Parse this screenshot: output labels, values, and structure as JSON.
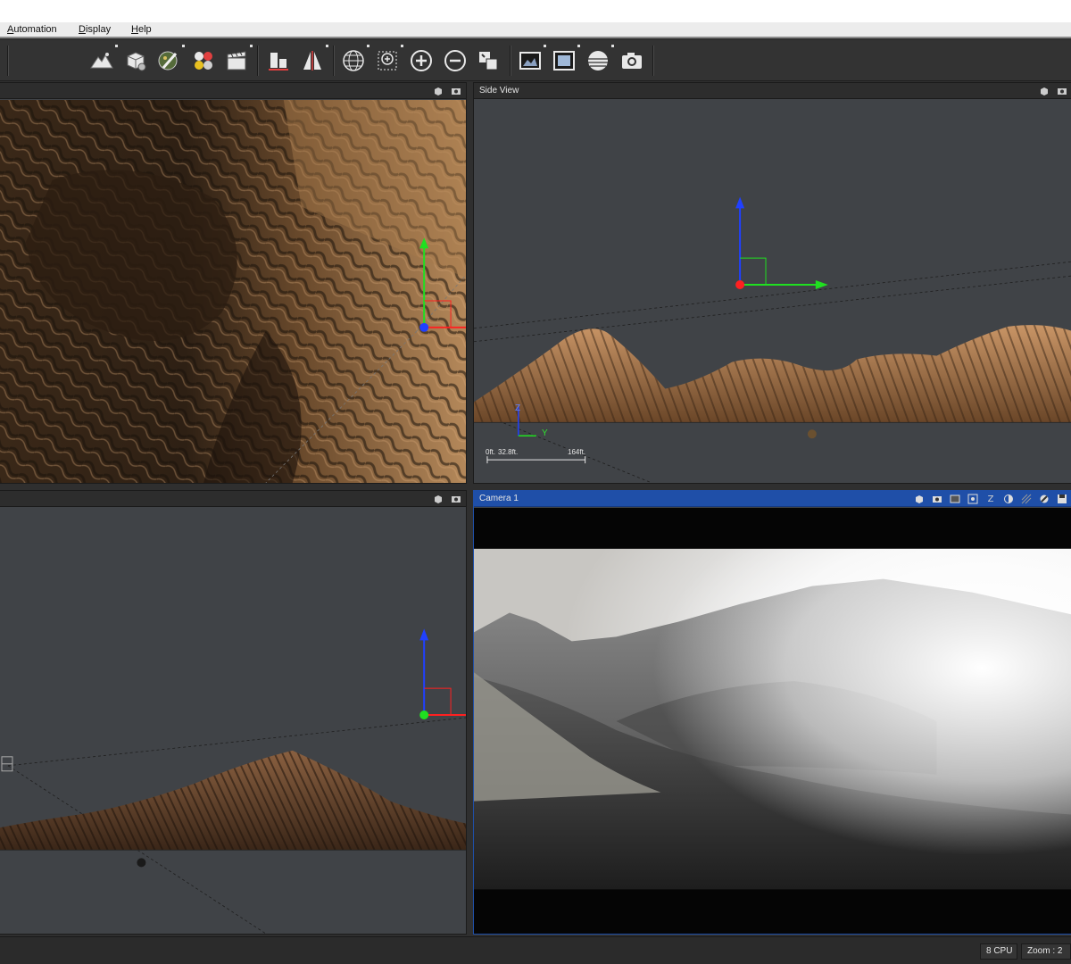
{
  "menubar": {
    "items": [
      {
        "label": "Automation",
        "underline": "A"
      },
      {
        "label": "Display",
        "underline": "D"
      },
      {
        "label": "Help",
        "underline": "H"
      }
    ]
  },
  "toolbar": {
    "buttons": [
      {
        "icon": "terrain-icon"
      },
      {
        "icon": "object-settings-icon"
      },
      {
        "icon": "paint-brush-icon"
      },
      {
        "icon": "color-balls-icon"
      },
      {
        "icon": "clapboard-icon"
      },
      {
        "icon": "align-icon"
      },
      {
        "icon": "mirror-icon"
      },
      {
        "icon": "globe-icon"
      },
      {
        "icon": "zoom-region-icon"
      },
      {
        "icon": "zoom-in-icon"
      },
      {
        "icon": "zoom-out-icon"
      },
      {
        "icon": "fit-view-icon"
      },
      {
        "icon": "render-preview-icon"
      },
      {
        "icon": "frame-icon"
      },
      {
        "icon": "sphere-icon"
      },
      {
        "icon": "camera-icon"
      }
    ]
  },
  "viewports": {
    "top_left": {
      "title": ""
    },
    "side_view": {
      "title": "Side View",
      "scale": {
        "start": "0ft.",
        "mid": "32.8ft.",
        "end": "164ft."
      },
      "axis_labels": {
        "z": "Z",
        "y": "Y"
      }
    },
    "bottom_left": {
      "title": ""
    },
    "camera": {
      "title": "Camera 1",
      "toolbar_letter": "Z"
    }
  },
  "statusbar": {
    "cpu": "8 CPU",
    "zoom": "Zoom : 2"
  },
  "colors": {
    "accent": "#1f4fa8",
    "axis_x": "#ff2020",
    "axis_y": "#20e020",
    "axis_z": "#2040ff",
    "terrain": "#a8784a"
  }
}
